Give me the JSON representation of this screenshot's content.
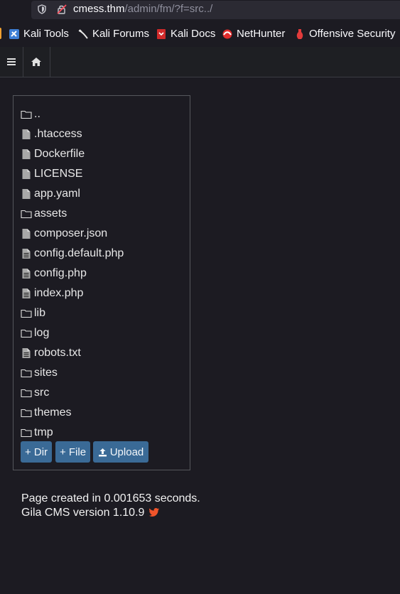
{
  "browser": {
    "url_host": "cmess.thm",
    "url_path": "/admin/fm/?f=src../"
  },
  "bookmarks": [
    {
      "label": "Kali Tools",
      "icon": "kali-tools-icon"
    },
    {
      "label": "Kali Forums",
      "icon": "kali-forums-icon"
    },
    {
      "label": "Kali Docs",
      "icon": "kali-docs-icon"
    },
    {
      "label": "NetHunter",
      "icon": "nethunter-icon"
    },
    {
      "label": "Offensive Security",
      "icon": "offensive-security-icon"
    }
  ],
  "nav": {
    "menu_icon": "hamburger-icon",
    "home_icon": "home-icon"
  },
  "files": [
    {
      "name": "..",
      "type": "folder"
    },
    {
      "name": ".htaccess",
      "type": "file"
    },
    {
      "name": "Dockerfile",
      "type": "file"
    },
    {
      "name": "LICENSE",
      "type": "file"
    },
    {
      "name": "app.yaml",
      "type": "file"
    },
    {
      "name": "assets",
      "type": "folder"
    },
    {
      "name": "composer.json",
      "type": "file"
    },
    {
      "name": "config.default.php",
      "type": "file-text"
    },
    {
      "name": "config.php",
      "type": "file-text"
    },
    {
      "name": "index.php",
      "type": "file-text"
    },
    {
      "name": "lib",
      "type": "folder"
    },
    {
      "name": "log",
      "type": "folder"
    },
    {
      "name": "robots.txt",
      "type": "file-text"
    },
    {
      "name": "sites",
      "type": "folder"
    },
    {
      "name": "src",
      "type": "folder"
    },
    {
      "name": "themes",
      "type": "folder"
    },
    {
      "name": "tmp",
      "type": "folder"
    }
  ],
  "actions": {
    "new_dir": "+ Dir",
    "new_file": "+ File",
    "upload": "Upload"
  },
  "footer": {
    "created": "Page created in 0.001653 seconds.",
    "version": "Gila CMS version 1.10.9"
  },
  "colors": {
    "background": "#1c1b22",
    "button": "#3a6a96",
    "twitter_icon": "#f0542a"
  }
}
